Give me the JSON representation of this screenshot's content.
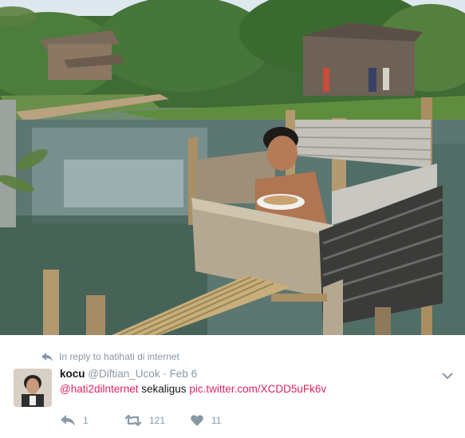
{
  "reply_context": {
    "prefix": "In reply to",
    "target": "hatihati di internet"
  },
  "tweet": {
    "display_name": "kocu",
    "handle": "@Diftian_Ucok",
    "separator": "·",
    "date": "Feb 6",
    "mention": "@hati2dilnternet",
    "text": " sekaligus ",
    "link": "pic.twitter.com/XCDD5uFk6v"
  },
  "actions": {
    "reply_count": "1",
    "retweet_count": "121",
    "like_count": "11"
  },
  "icons": {
    "reply": "reply-icon",
    "retweet": "retweet-icon",
    "like": "heart-icon",
    "more": "chevron-down-icon"
  },
  "colors": {
    "link": "#e0245e",
    "meta": "#8899a6",
    "text": "#14171a"
  }
}
